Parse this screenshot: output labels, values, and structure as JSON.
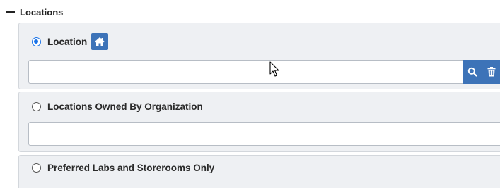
{
  "section": {
    "title": "Locations",
    "icon": "minus-collapse-icon"
  },
  "options": [
    {
      "label": "Location",
      "selected": true,
      "icon": "home-icon",
      "input_value": "",
      "input_placeholder": "",
      "actions": [
        "search-icon",
        "trash-icon"
      ]
    },
    {
      "label": "Locations Owned By Organization",
      "selected": false,
      "input_value": "",
      "input_placeholder": ""
    },
    {
      "label": "Preferred Labs and Storerooms Only",
      "selected": false
    }
  ],
  "colors": {
    "accent": "#3d73b8",
    "radio_selected": "#1a73e8",
    "panel_bg": "#eef0f3",
    "panel_border": "#d3d7dc"
  }
}
